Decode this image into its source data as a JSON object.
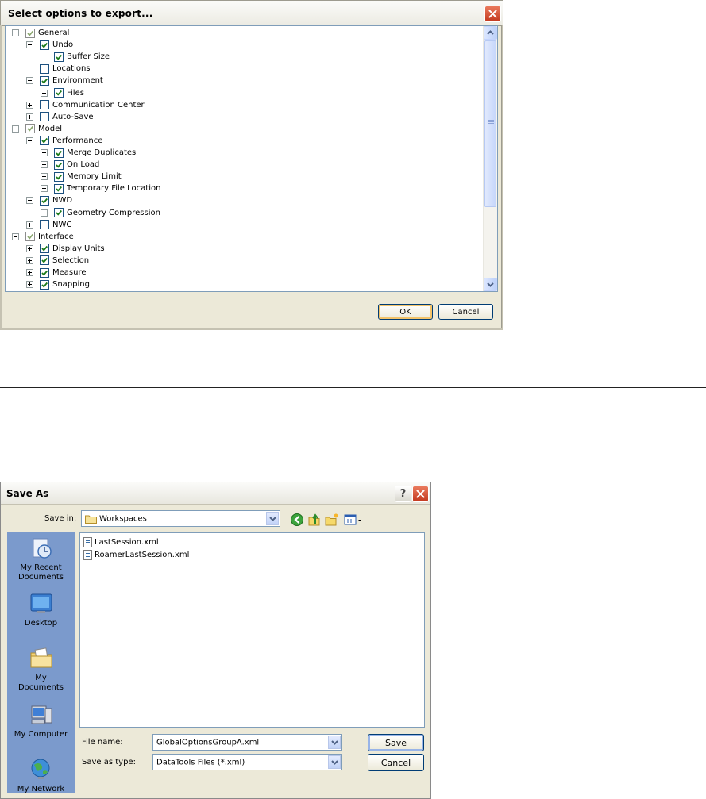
{
  "export_dialog": {
    "title": "Select options to export...",
    "tree": [
      {
        "label": "General",
        "expander": "minus",
        "checked": true,
        "grey": true
      },
      {
        "label": "Undo",
        "expander": "minus",
        "checked": true
      },
      {
        "label": "Buffer Size",
        "expander": "none",
        "checked": true
      },
      {
        "label": "Locations",
        "expander": "none",
        "checked": false
      },
      {
        "label": "Environment",
        "expander": "minus",
        "checked": true
      },
      {
        "label": "Files",
        "expander": "plus",
        "checked": true
      },
      {
        "label": "Communication Center",
        "expander": "plus",
        "checked": false
      },
      {
        "label": "Auto-Save",
        "expander": "plus",
        "checked": false
      },
      {
        "label": "Model",
        "expander": "minus",
        "checked": true,
        "grey": true
      },
      {
        "label": "Performance",
        "expander": "minus",
        "checked": true
      },
      {
        "label": "Merge Duplicates",
        "expander": "plus",
        "checked": true
      },
      {
        "label": "On Load",
        "expander": "plus",
        "checked": true
      },
      {
        "label": "Memory Limit",
        "expander": "plus",
        "checked": true
      },
      {
        "label": "Temporary File Location",
        "expander": "plus",
        "checked": true
      },
      {
        "label": "NWD",
        "expander": "minus",
        "checked": true
      },
      {
        "label": "Geometry Compression",
        "expander": "plus",
        "checked": true
      },
      {
        "label": "NWC",
        "expander": "plus",
        "checked": false
      },
      {
        "label": "Interface",
        "expander": "minus",
        "checked": true,
        "grey": true
      },
      {
        "label": "Display Units",
        "expander": "plus",
        "checked": true
      },
      {
        "label": "Selection",
        "expander": "plus",
        "checked": true
      },
      {
        "label": "Measure",
        "expander": "plus",
        "checked": true
      },
      {
        "label": "Snapping",
        "expander": "plus",
        "checked": true
      }
    ],
    "ok_label": "OK",
    "cancel_label": "Cancel",
    "close_icon": "close-icon"
  },
  "saveas_dialog": {
    "title": "Save As",
    "help_label": "?",
    "save_in_label": "Save in:",
    "save_in_value": "Workspaces",
    "places": [
      {
        "label": "My Recent Documents",
        "icon": "recent-documents-icon"
      },
      {
        "label": "Desktop",
        "icon": "desktop-icon"
      },
      {
        "label": "My Documents",
        "icon": "my-documents-icon"
      },
      {
        "label": "My Computer",
        "icon": "my-computer-icon"
      },
      {
        "label": "My Network",
        "icon": "my-network-icon"
      }
    ],
    "files": [
      "LastSession.xml",
      "RoamerLastSession.xml"
    ],
    "file_name_label": "File name:",
    "file_name_value": "GlobalOptionsGroupA.xml",
    "save_type_label": "Save as type:",
    "save_type_value": "DataTools Files (*.xml)",
    "save_label": "Save",
    "cancel_label": "Cancel"
  }
}
